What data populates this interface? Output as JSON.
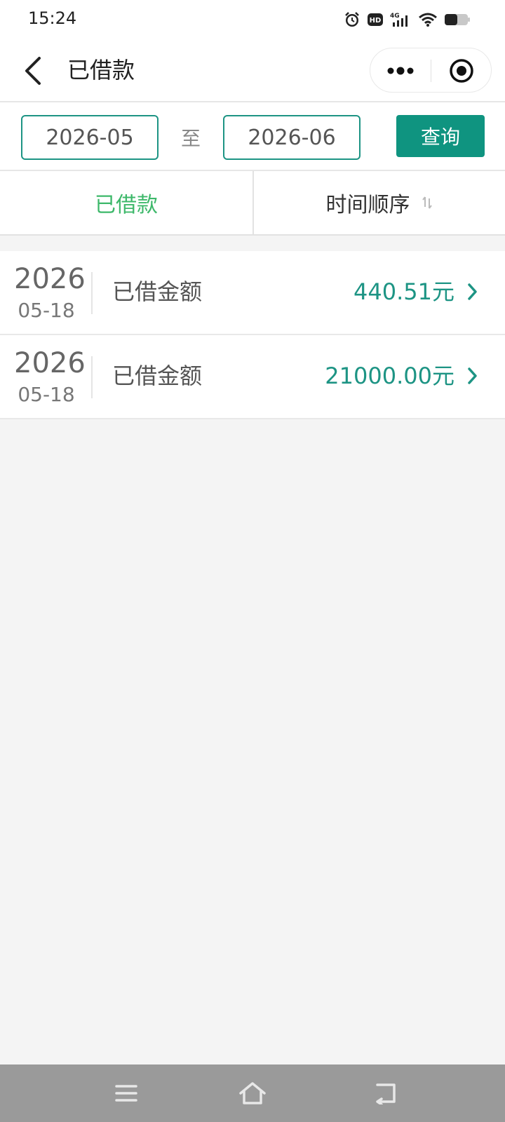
{
  "status_bar": {
    "time": "15:24",
    "icons": [
      "alarm-icon",
      "hd-icon",
      "signal-4g-icon",
      "wifi-icon",
      "battery-icon"
    ]
  },
  "nav": {
    "title": "已借款",
    "back_icon": "back-arrow-icon",
    "more_icon": "more-dots-icon",
    "close_icon": "target-close-icon"
  },
  "filter": {
    "start_date": "2026-05",
    "to_label": "至",
    "end_date": "2026-06",
    "query_label": "查询"
  },
  "tabs": [
    {
      "label": "已借款",
      "active": true
    },
    {
      "label": "时间顺序",
      "icon": "sort-icon",
      "active": false
    }
  ],
  "records": [
    {
      "year": "2026",
      "date": "05-18",
      "label": "已借金额",
      "amount": "440.51元"
    },
    {
      "year": "2026",
      "date": "05-18",
      "label": "已借金额",
      "amount": "21000.00元"
    }
  ],
  "system_nav": {
    "buttons": [
      "menu-icon",
      "home-icon",
      "back-icon"
    ]
  },
  "colors": {
    "accent": "#0f9480",
    "amount": "#1d9484",
    "active_tab": "#3db86a",
    "system_nav_bg": "#9a9a9a"
  }
}
